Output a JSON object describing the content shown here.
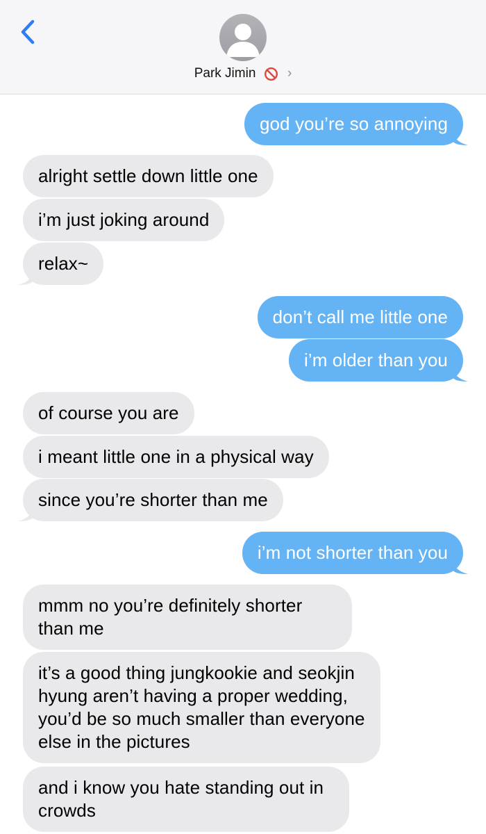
{
  "header": {
    "contact_name": "Park Jimin",
    "status_icon": "blocked-icon",
    "chevron": "›",
    "back_icon": "chevron-left-icon",
    "accent_color": "#2f7cf6"
  },
  "colors": {
    "outgoing_bubble": "#64b3f4",
    "incoming_bubble": "#e9e9eb",
    "header_bg": "#f6f6f8",
    "blocked_red": "#e0463a"
  },
  "messages": [
    {
      "direction": "out",
      "text": "god you’re so annoying"
    },
    {
      "direction": "in",
      "text": "alright settle down little one"
    },
    {
      "direction": "in",
      "text": "i’m just joking around"
    },
    {
      "direction": "in",
      "text": "relax~"
    },
    {
      "direction": "out",
      "text": "don’t call me little one"
    },
    {
      "direction": "out",
      "text": "i’m older than you"
    },
    {
      "direction": "in",
      "text": "of course you are"
    },
    {
      "direction": "in",
      "text": "i meant little one in a physical way"
    },
    {
      "direction": "in",
      "text": "since you’re shorter than me"
    },
    {
      "direction": "out",
      "text": "i’m not shorter than you"
    },
    {
      "direction": "in",
      "text": "mmm no you’re definitely shorter than me"
    },
    {
      "direction": "in",
      "text": "it’s a good thing jungkookie and seokjin hyung aren’t having a proper wedding, you’d be so much smaller than everyone else in the pictures"
    },
    {
      "direction": "in",
      "text": "and i know you hate standing out in crowds"
    }
  ]
}
